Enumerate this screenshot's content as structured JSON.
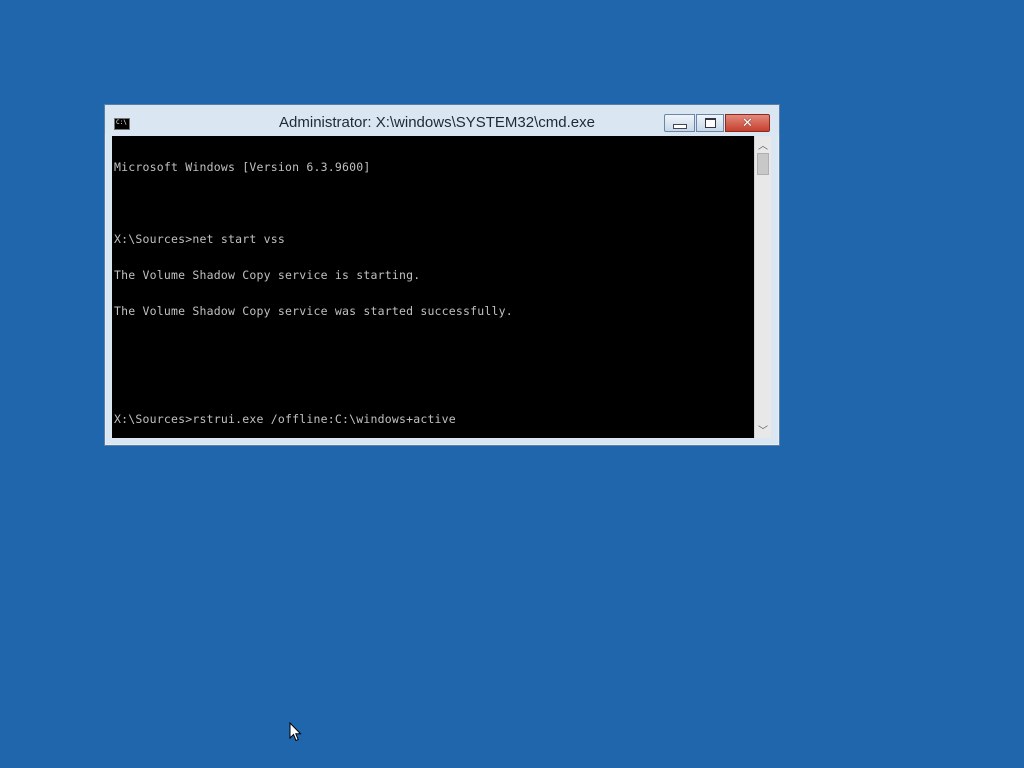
{
  "window": {
    "title": "Administrator: X:\\windows\\SYSTEM32\\cmd.exe",
    "icon": "cmd-icon",
    "icon_text": "C:\\",
    "controls": {
      "minimize": "minimize-icon",
      "maximize": "maximize-icon",
      "close": "close-icon",
      "close_glyph": "✕"
    }
  },
  "console": {
    "lines": [
      "Microsoft Windows [Version 6.3.9600]",
      "",
      "X:\\Sources>net start vss",
      "The Volume Shadow Copy service is starting.",
      "The Volume Shadow Copy service was started successfully.",
      "",
      "",
      "X:\\Sources>rstrui.exe /offline:C:\\windows+active"
    ]
  },
  "scrollbar": {
    "up_glyph": "︿",
    "down_glyph": "﹀"
  },
  "colors": {
    "desktop": "#1f66ad",
    "console_bg": "#000000",
    "console_fg": "#c0c0c0",
    "close_button": "#c7402e"
  }
}
